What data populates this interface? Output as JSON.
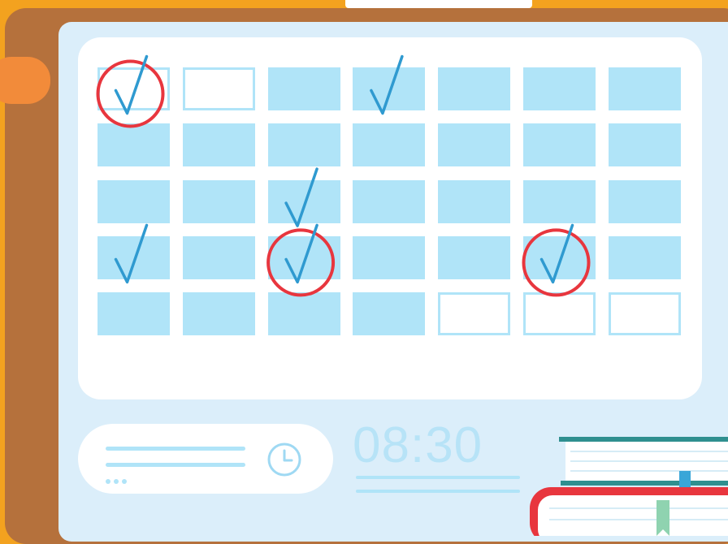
{
  "clock": {
    "time": "08:30"
  },
  "calendar": {
    "columns": 7,
    "rows": 5,
    "cells": [
      [
        "empty",
        "empty",
        "filled",
        "filled",
        "filled",
        "filled",
        "filled"
      ],
      [
        "filled",
        "filled",
        "filled",
        "filled",
        "filled",
        "filled",
        "filled"
      ],
      [
        "filled",
        "filled",
        "filled",
        "filled",
        "filled",
        "filled",
        "filled"
      ],
      [
        "filled",
        "filled",
        "filled",
        "filled",
        "filled",
        "filled",
        "filled"
      ],
      [
        "filled",
        "filled",
        "filled",
        "filled",
        "empty",
        "empty",
        "empty"
      ]
    ],
    "checked": [
      [
        0,
        0
      ],
      [
        0,
        3
      ],
      [
        2,
        2
      ],
      [
        3,
        0
      ],
      [
        3,
        2
      ],
      [
        3,
        5
      ]
    ],
    "circled": [
      [
        0,
        0
      ],
      [
        3,
        2
      ],
      [
        3,
        5
      ]
    ]
  },
  "colors": {
    "background": "#f3a21f",
    "frame": "#b5713c",
    "screen": "#dbeefa",
    "cell": "#b0e4f8",
    "check": "#2f9ad0",
    "circle": "#e8363e",
    "book_teal": "#2f8f8f",
    "book_red": "#e8363e"
  },
  "icons": [
    "clip-icon",
    "check-icon",
    "clock-icon",
    "book-stack-icon",
    "bookmark-icon"
  ]
}
